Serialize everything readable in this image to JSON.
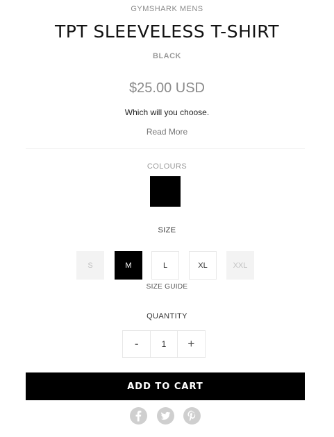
{
  "product": {
    "brand": "GYMSHARK MENS",
    "title": "TPT SLEEVELESS T-SHIRT",
    "colour_name": "BLACK",
    "price": "$25.00 USD",
    "tagline": "Which will you choose.",
    "read_more": "Read More"
  },
  "colours": {
    "label": "COLOURS",
    "swatches": [
      {
        "name": "Black",
        "color": "#000000",
        "selected": true
      }
    ]
  },
  "sizes": {
    "label": "SIZE",
    "options": [
      {
        "label": "S",
        "state": "unavailable"
      },
      {
        "label": "M",
        "state": "selected"
      },
      {
        "label": "L",
        "state": "available"
      },
      {
        "label": "XL",
        "state": "available"
      },
      {
        "label": "XXL",
        "state": "unavailable"
      }
    ],
    "guide_label": "SIZE GUIDE"
  },
  "quantity": {
    "label": "QUANTITY",
    "value": "1",
    "decrement": "-",
    "increment": "+"
  },
  "cart": {
    "add_label": "ADD TO CART"
  },
  "share": {
    "icons": [
      "facebook-icon",
      "twitter-icon",
      "pinterest-icon"
    ],
    "color": "#cfcfcf"
  }
}
